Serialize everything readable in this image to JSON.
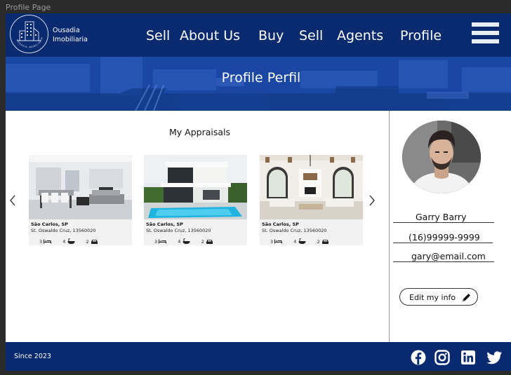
{
  "frame_label": "Profile Page",
  "brand": {
    "line1": "Ousadia",
    "line2": "Imobiliaria",
    "logo_ring_text": "OUSADIA IMOBILIARIA"
  },
  "nav": {
    "items": [
      {
        "label": "Sell"
      },
      {
        "label": "About Us"
      },
      {
        "label": "Buy"
      },
      {
        "label": "Sell"
      },
      {
        "label": "Agents"
      },
      {
        "label": "Profile"
      }
    ],
    "menu_icon": "hamburger-menu-icon"
  },
  "hero": {
    "title": "Profile Perfil"
  },
  "appraisals": {
    "title": "My Appraisals",
    "prev_icon": "chevron-left-icon",
    "next_icon": "chevron-right-icon",
    "cards": [
      {
        "city": "São Carlos, SP",
        "address": "St. Oswaldo Cruz, 13560020",
        "beds": "3",
        "baths": "4",
        "garages": "2"
      },
      {
        "city": "São Carlos, SP",
        "address": "St. Oswaldo Cruz, 13560020",
        "beds": "3",
        "baths": "4",
        "garages": "2"
      },
      {
        "city": "São Carlos, SP",
        "address": "St. Oswaldo Cruz, 13560020",
        "beds": "3",
        "baths": "4",
        "garages": "2"
      }
    ]
  },
  "profile": {
    "name": "Garry Barry",
    "phone": "(16)99999-9999",
    "email": "gary@email.com",
    "edit_label": "Edit my info",
    "edit_icon": "pencil-icon"
  },
  "footer": {
    "since": "Since 2023",
    "social": [
      "facebook-icon",
      "instagram-icon",
      "linkedin-icon",
      "twitter-icon"
    ]
  },
  "colors": {
    "brand_navy": "#0a2a70",
    "hero_blue": "#1a46a0",
    "white": "#ffffff"
  }
}
